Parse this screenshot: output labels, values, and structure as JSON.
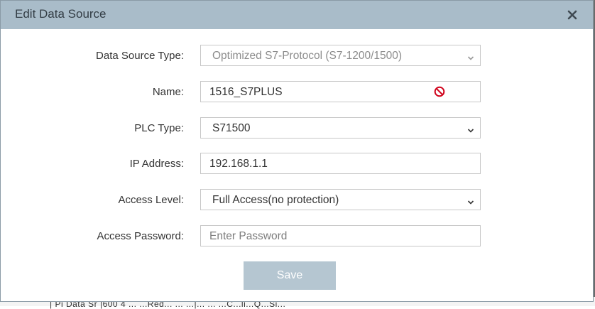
{
  "dialog": {
    "title": "Edit Data Source",
    "close_icon": "close-icon"
  },
  "form": {
    "data_source_type": {
      "label": "Data Source Type:",
      "value": "Optimized S7-Protocol (S7-1200/1500)"
    },
    "name": {
      "label": "Name:",
      "value": "1516_S7PLUS",
      "status_icon": "no-entry-icon",
      "status_color": "#d0021b"
    },
    "plc_type": {
      "label": "PLC Type:",
      "value": "S71500"
    },
    "ip_address": {
      "label": "IP Address:",
      "value": "192.168.1.1"
    },
    "access_level": {
      "label": "Access Level:",
      "value": "Full Access(no protection)"
    },
    "access_password": {
      "label": "Access Password:",
      "value": "",
      "placeholder": "Enter Password"
    }
  },
  "actions": {
    "save_label": "Save"
  },
  "background": {
    "partial_text": "| Pi  Data  Sr  |600  4 ...          ...Red...          ...              ...|...          ...    ...C...li...Q...Si..."
  },
  "colors": {
    "header_bg": "#a9bcc9",
    "save_bg": "#b5c6d1"
  }
}
